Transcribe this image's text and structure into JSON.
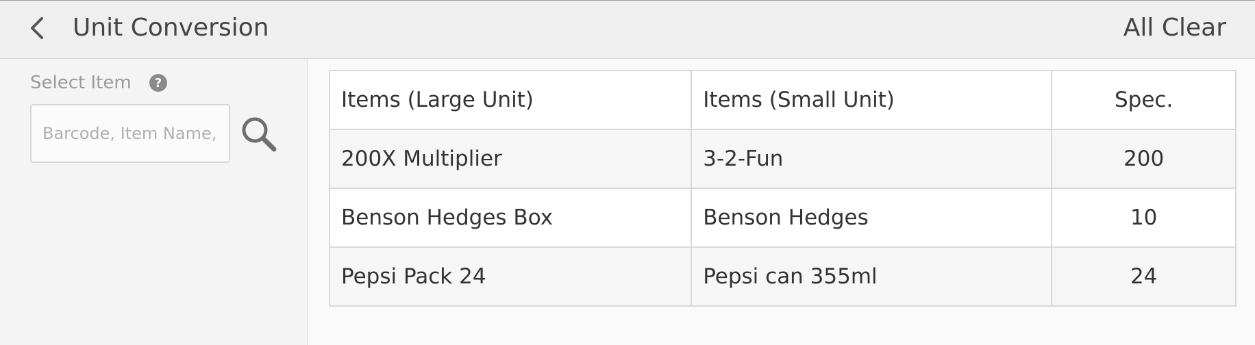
{
  "header": {
    "title": "Unit Conversion",
    "all_clear_label": "All Clear"
  },
  "left_panel": {
    "select_item_label": "Select Item",
    "search_placeholder": "Barcode, Item Name, First Letter",
    "search_value": ""
  },
  "table": {
    "headers": [
      "Items (Large Unit)",
      "Items (Small Unit)",
      "Spec."
    ],
    "rows": [
      [
        "200X Multiplier",
        "3-2-Fun",
        "200"
      ],
      [
        "Benson Hedges Box",
        "Benson Hedges",
        "10"
      ],
      [
        "Pepsi Pack 24",
        "Pepsi can 355ml",
        "24"
      ]
    ]
  },
  "icons": {
    "back": "chevron-left-icon",
    "help": "question-circle-icon",
    "search": "search-icon"
  },
  "colors": {
    "header_bg": "#efefef",
    "panel_bg": "#f4f4f4",
    "text": "#333333",
    "muted": "#9a9a9a"
  }
}
